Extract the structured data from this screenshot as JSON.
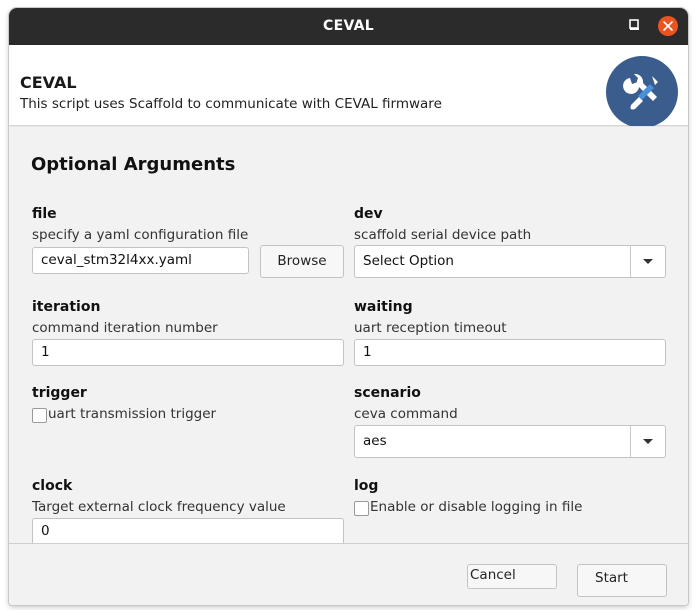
{
  "window": {
    "title": "CEVAL"
  },
  "header": {
    "title": "CEVAL",
    "description": "This script uses Scaffold to communicate with CEVAL firmware",
    "icon": "tools-icon"
  },
  "section": {
    "title": "Optional Arguments"
  },
  "args": {
    "file": {
      "name": "file",
      "help": "specify a yaml configuration file",
      "value": "ceval_stm32l4xx.yaml",
      "browse_label": "Browse"
    },
    "dev": {
      "name": "dev",
      "help": "scaffold serial device path",
      "selected": "Select Option"
    },
    "iteration": {
      "name": "iteration",
      "help": "command iteration number",
      "value": "1"
    },
    "waiting": {
      "name": "waiting",
      "help": "uart reception timeout",
      "value": "1"
    },
    "trigger": {
      "name": "trigger",
      "label": "uart transmission trigger",
      "checked": false
    },
    "scenario": {
      "name": "scenario",
      "help": "ceva command",
      "selected": "aes"
    },
    "clock": {
      "name": "clock",
      "help": "Target external clock frequency value",
      "value": "0"
    },
    "log": {
      "name": "log",
      "label": "Enable or disable logging in file",
      "checked": false
    }
  },
  "footer": {
    "cancel_label": "Cancel",
    "start_label": "Start"
  },
  "colors": {
    "titlebar": "#2b2b2b",
    "close": "#e95420",
    "icon_bg": "#3a5d8d"
  }
}
